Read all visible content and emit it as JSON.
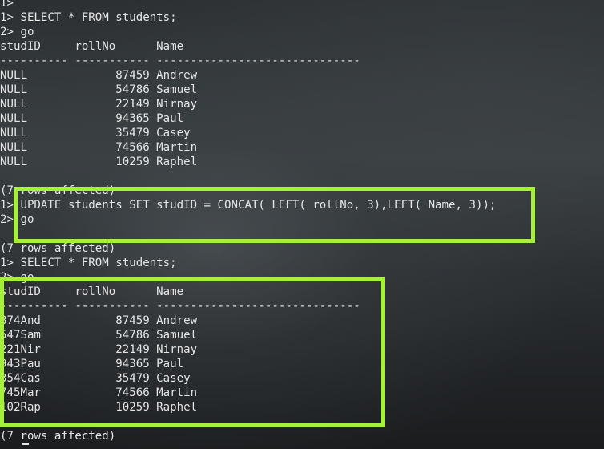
{
  "terminal": {
    "lines": [
      "1>",
      "1> SELECT * FROM students;",
      "2> go",
      "studID     rollNo      Name",
      "---------- ----------- ------------------------------",
      "NULL             87459 Andrew",
      "NULL             54786 Samuel",
      "NULL             22149 Nirnay",
      "NULL             94365 Paul",
      "NULL             35479 Casey",
      "NULL             74566 Martin",
      "NULL             10259 Raphel",
      "",
      "(7 rows affected)",
      "1> UPDATE students SET studID = CONCAT( LEFT( rollNo, 3),LEFT( Name, 3));",
      "2> go",
      "",
      "(7 rows affected)",
      "1> SELECT * FROM students;",
      "2> go",
      "studID     rollNo      Name",
      "---------- ----------- ------------------------------",
      "874And           87459 Andrew",
      "547Sam           54786 Samuel",
      "221Nir           22149 Nirnay",
      "943Pau           94365 Paul",
      "354Cas           35479 Casey",
      "745Mar           74566 Martin",
      "102Rap           10259 Raphel",
      "",
      "(7 rows affected)"
    ]
  },
  "colors": {
    "text": "#e4e4e4",
    "highlight": "#a6f03a"
  }
}
